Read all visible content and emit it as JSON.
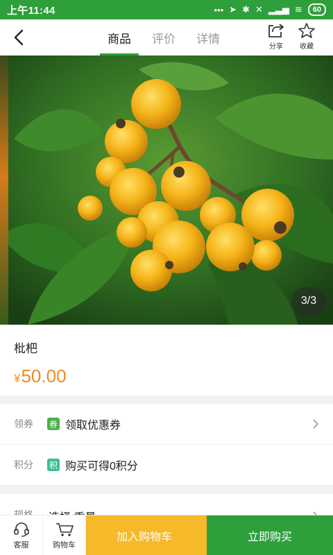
{
  "status_bar": {
    "time": "上午11:44",
    "battery": "60"
  },
  "nav": {
    "tabs": [
      {
        "label": "商品",
        "active": true
      },
      {
        "label": "评价",
        "active": false
      },
      {
        "label": "详情",
        "active": false
      }
    ],
    "share_label": "分享",
    "favorite_label": "收藏"
  },
  "gallery": {
    "counter": "3/3"
  },
  "product": {
    "name": "枇杷",
    "currency": "¥",
    "price": "50.00"
  },
  "rows": {
    "coupon": {
      "key": "领券",
      "tag": "券",
      "value": "领取优惠券"
    },
    "points": {
      "key": "积分",
      "tag": "积",
      "value": "购买可得0积分"
    },
    "spec": {
      "key": "规格",
      "value": "选择 重量"
    }
  },
  "bottom_bar": {
    "service_label": "客服",
    "cart_label": "购物车",
    "add_to_cart": "加入购物车",
    "buy_now": "立即购买"
  },
  "colors": {
    "brand_green": "#2e9f3a",
    "price_orange": "#f08a1d",
    "cart_yellow": "#f5b92a",
    "coupon_tag": "#4cb050",
    "points_tag": "#3dbf8e"
  }
}
